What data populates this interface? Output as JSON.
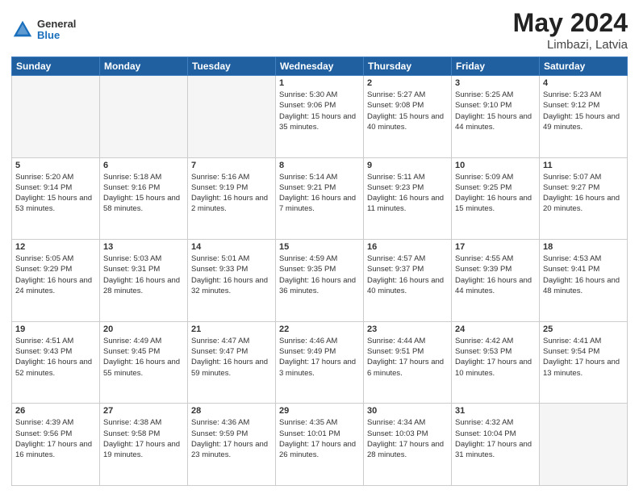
{
  "header": {
    "logo_general": "General",
    "logo_blue": "Blue",
    "title": "May 2024",
    "location": "Limbazi, Latvia"
  },
  "days_of_week": [
    "Sunday",
    "Monday",
    "Tuesday",
    "Wednesday",
    "Thursday",
    "Friday",
    "Saturday"
  ],
  "weeks": [
    [
      {
        "day": "",
        "empty": true
      },
      {
        "day": "",
        "empty": true
      },
      {
        "day": "",
        "empty": true
      },
      {
        "day": "1",
        "sunrise": "5:30 AM",
        "sunset": "9:06 PM",
        "daylight": "15 hours and 35 minutes."
      },
      {
        "day": "2",
        "sunrise": "5:27 AM",
        "sunset": "9:08 PM",
        "daylight": "15 hours and 40 minutes."
      },
      {
        "day": "3",
        "sunrise": "5:25 AM",
        "sunset": "9:10 PM",
        "daylight": "15 hours and 44 minutes."
      },
      {
        "day": "4",
        "sunrise": "5:23 AM",
        "sunset": "9:12 PM",
        "daylight": "15 hours and 49 minutes."
      }
    ],
    [
      {
        "day": "5",
        "sunrise": "5:20 AM",
        "sunset": "9:14 PM",
        "daylight": "15 hours and 53 minutes."
      },
      {
        "day": "6",
        "sunrise": "5:18 AM",
        "sunset": "9:16 PM",
        "daylight": "15 hours and 58 minutes."
      },
      {
        "day": "7",
        "sunrise": "5:16 AM",
        "sunset": "9:19 PM",
        "daylight": "16 hours and 2 minutes."
      },
      {
        "day": "8",
        "sunrise": "5:14 AM",
        "sunset": "9:21 PM",
        "daylight": "16 hours and 7 minutes."
      },
      {
        "day": "9",
        "sunrise": "5:11 AM",
        "sunset": "9:23 PM",
        "daylight": "16 hours and 11 minutes."
      },
      {
        "day": "10",
        "sunrise": "5:09 AM",
        "sunset": "9:25 PM",
        "daylight": "16 hours and 15 minutes."
      },
      {
        "day": "11",
        "sunrise": "5:07 AM",
        "sunset": "9:27 PM",
        "daylight": "16 hours and 20 minutes."
      }
    ],
    [
      {
        "day": "12",
        "sunrise": "5:05 AM",
        "sunset": "9:29 PM",
        "daylight": "16 hours and 24 minutes."
      },
      {
        "day": "13",
        "sunrise": "5:03 AM",
        "sunset": "9:31 PM",
        "daylight": "16 hours and 28 minutes."
      },
      {
        "day": "14",
        "sunrise": "5:01 AM",
        "sunset": "9:33 PM",
        "daylight": "16 hours and 32 minutes."
      },
      {
        "day": "15",
        "sunrise": "4:59 AM",
        "sunset": "9:35 PM",
        "daylight": "16 hours and 36 minutes."
      },
      {
        "day": "16",
        "sunrise": "4:57 AM",
        "sunset": "9:37 PM",
        "daylight": "16 hours and 40 minutes."
      },
      {
        "day": "17",
        "sunrise": "4:55 AM",
        "sunset": "9:39 PM",
        "daylight": "16 hours and 44 minutes."
      },
      {
        "day": "18",
        "sunrise": "4:53 AM",
        "sunset": "9:41 PM",
        "daylight": "16 hours and 48 minutes."
      }
    ],
    [
      {
        "day": "19",
        "sunrise": "4:51 AM",
        "sunset": "9:43 PM",
        "daylight": "16 hours and 52 minutes."
      },
      {
        "day": "20",
        "sunrise": "4:49 AM",
        "sunset": "9:45 PM",
        "daylight": "16 hours and 55 minutes."
      },
      {
        "day": "21",
        "sunrise": "4:47 AM",
        "sunset": "9:47 PM",
        "daylight": "16 hours and 59 minutes."
      },
      {
        "day": "22",
        "sunrise": "4:46 AM",
        "sunset": "9:49 PM",
        "daylight": "17 hours and 3 minutes."
      },
      {
        "day": "23",
        "sunrise": "4:44 AM",
        "sunset": "9:51 PM",
        "daylight": "17 hours and 6 minutes."
      },
      {
        "day": "24",
        "sunrise": "4:42 AM",
        "sunset": "9:53 PM",
        "daylight": "17 hours and 10 minutes."
      },
      {
        "day": "25",
        "sunrise": "4:41 AM",
        "sunset": "9:54 PM",
        "daylight": "17 hours and 13 minutes."
      }
    ],
    [
      {
        "day": "26",
        "sunrise": "4:39 AM",
        "sunset": "9:56 PM",
        "daylight": "17 hours and 16 minutes."
      },
      {
        "day": "27",
        "sunrise": "4:38 AM",
        "sunset": "9:58 PM",
        "daylight": "17 hours and 19 minutes."
      },
      {
        "day": "28",
        "sunrise": "4:36 AM",
        "sunset": "9:59 PM",
        "daylight": "17 hours and 23 minutes."
      },
      {
        "day": "29",
        "sunrise": "4:35 AM",
        "sunset": "10:01 PM",
        "daylight": "17 hours and 26 minutes."
      },
      {
        "day": "30",
        "sunrise": "4:34 AM",
        "sunset": "10:03 PM",
        "daylight": "17 hours and 28 minutes."
      },
      {
        "day": "31",
        "sunrise": "4:32 AM",
        "sunset": "10:04 PM",
        "daylight": "17 hours and 31 minutes."
      },
      {
        "day": "",
        "empty": true
      }
    ]
  ]
}
